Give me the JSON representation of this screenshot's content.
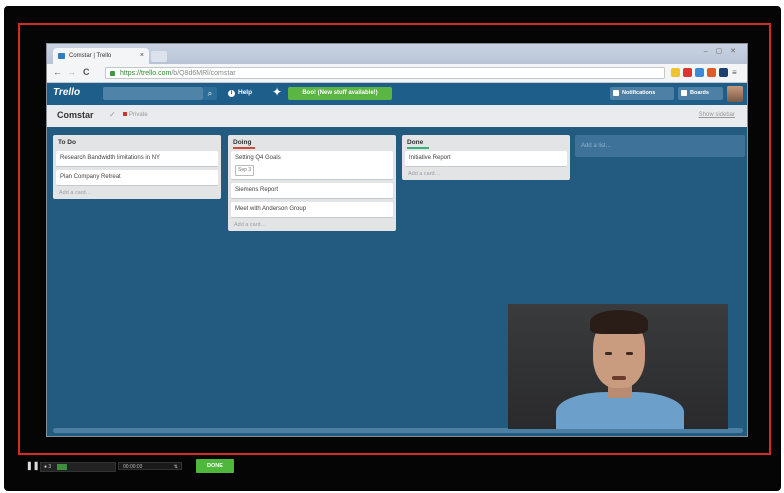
{
  "browser": {
    "tab_title": "Comstar | Trello",
    "tab_close": "×",
    "window_controls": "– ▢ ✕",
    "nav_back": "←",
    "nav_forward": "→",
    "nav_reload": "C",
    "url_secure": "https://trello.com",
    "url_path": "/b/Q8d6MRl/comstar"
  },
  "header": {
    "logo": "Trello",
    "search_icon": "⌕",
    "help_label": "Help",
    "help_icon": "i",
    "new_stuff": "Boo! (New stuff available!)",
    "notifications_label": "Notifications",
    "boards_label": "Boards"
  },
  "board": {
    "name": "Comstar",
    "star": "✓",
    "privacy": "Private",
    "show_sidebar": "Show sidebar",
    "lists": [
      {
        "title": "To Do",
        "cards": [
          {
            "text": "Research Bandwidth limitations in NY",
            "badge": ""
          },
          {
            "text": "Plan Company Retreat",
            "badge": ""
          }
        ],
        "add_card": "Add a card…"
      },
      {
        "title": "Doing",
        "cards": [
          {
            "text": "Setting Q4 Goals",
            "badge": "Sep 3"
          },
          {
            "text": "Siemens Report",
            "badge": ""
          },
          {
            "text": "Meet with Anderson Group",
            "badge": ""
          }
        ],
        "add_card": "Add a card…"
      },
      {
        "title": "Done",
        "cards": [
          {
            "text": "Initiative Report",
            "badge": ""
          }
        ],
        "add_card": "Add a card…"
      }
    ],
    "add_list": "Add a list…"
  },
  "recorder": {
    "pause": "❚❚",
    "level_label": "● 3",
    "time": "00:00:03",
    "time_arrow": "⇅",
    "done_label": "DONE",
    "recording_progress": 0.18
  },
  "colors": {
    "header": "#1d5f8a",
    "board_bg": "#235b80",
    "doing_accent": "#d44a3a",
    "done_accent": "#34b27d",
    "new_stuff": "#5ab543",
    "record_frame": "#d42a22"
  }
}
